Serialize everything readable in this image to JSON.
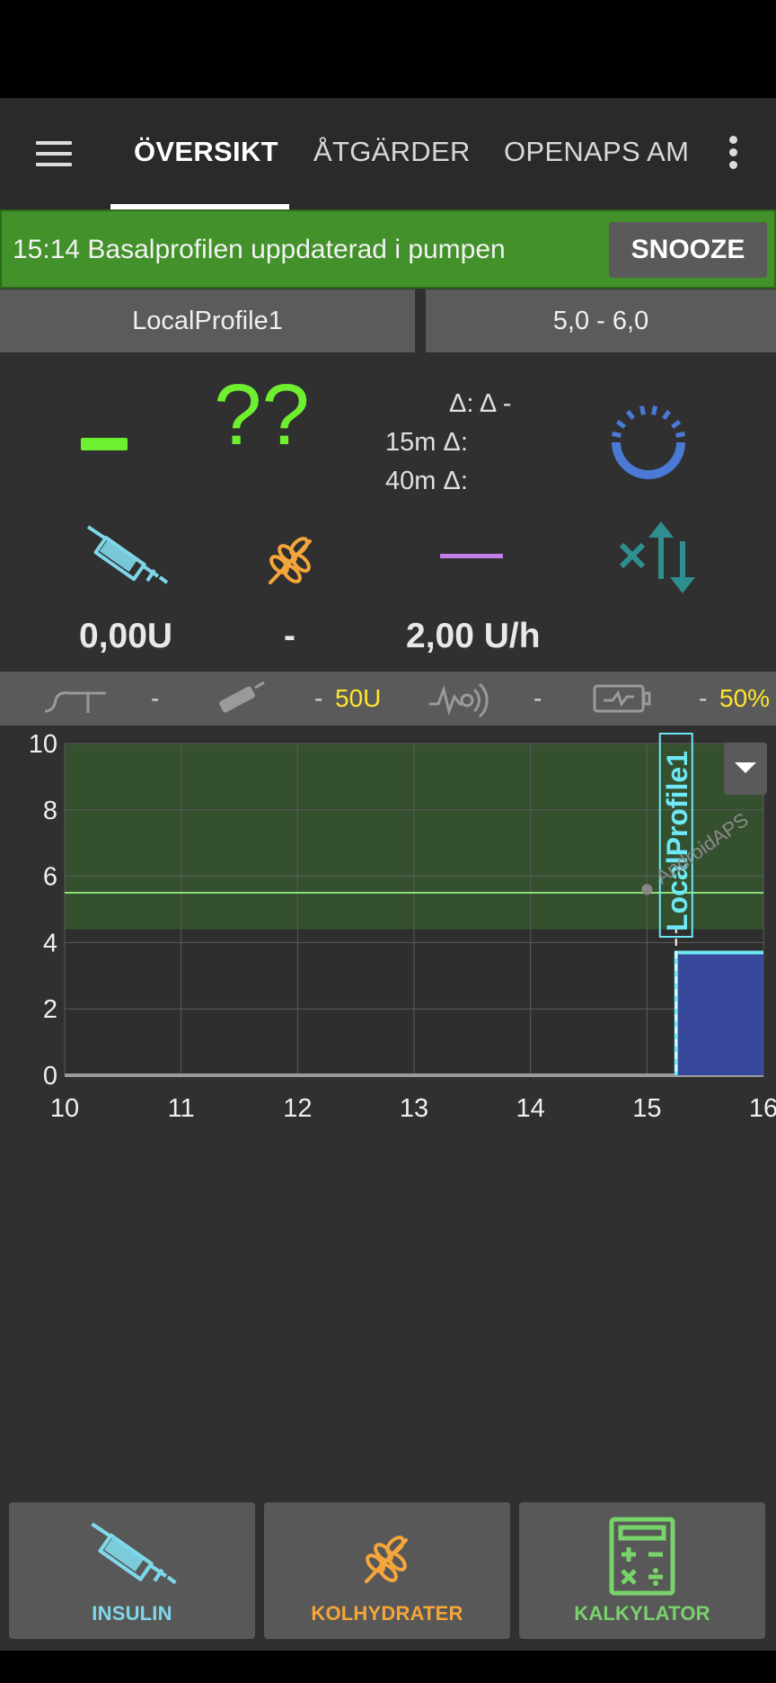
{
  "appbar": {
    "tabs": [
      {
        "label": "ÖVERSIKT",
        "active": true
      },
      {
        "label": "ÅTGÄRDER",
        "active": false
      },
      {
        "label": "OPENAPS AM",
        "active": false
      }
    ],
    "menu_icon": "hamburger-menu-icon",
    "overflow_icon": "more-vert-icon"
  },
  "notification": {
    "text": "15:14 Basalprofilen uppdaterad i pumpen",
    "action": "SNOOZE",
    "color": "#43912a"
  },
  "profile": {
    "name": "LocalProfile1",
    "target": "5,0 - 6,0"
  },
  "glucose": {
    "value": "??",
    "trend": "-",
    "delta": "Δ: Δ -",
    "delta_15m": "15m Δ:",
    "delta_40m": "40m Δ:",
    "color": "#6ef030"
  },
  "info": {
    "iob": "0,00U",
    "cob": "-",
    "basal": "2,00 U/h",
    "icons": [
      "syringe-icon",
      "wheat-icon",
      "basal-line-icon",
      "sensitivity-arrows-icon"
    ]
  },
  "pump_status": {
    "cannula": "-",
    "reservoir_age": "-",
    "reservoir_level": "50U",
    "sensor": "-",
    "battery_age": "-",
    "battery_level": "50%"
  },
  "chart_data": {
    "type": "line",
    "x_ticks": [
      "10",
      "11",
      "12",
      "13",
      "14",
      "15",
      "16"
    ],
    "y_ticks": [
      "0",
      "2",
      "4",
      "6",
      "8",
      "10"
    ],
    "xlim": [
      10,
      16
    ],
    "ylim": [
      0,
      10
    ],
    "target_range": [
      4.4,
      10
    ],
    "target_line": 5.5,
    "basal_block": {
      "start": 15.25,
      "end": 16,
      "value": 3.7
    },
    "profile_switch": {
      "x": 15.25,
      "label": "LocalProfile1"
    },
    "watermark": "AndroidAPS",
    "grid": true
  },
  "actions": [
    {
      "label": "INSULIN",
      "color": "#7fd8ea",
      "icon": "syringe-icon"
    },
    {
      "label": "KOLHYDRATER",
      "color": "#f5a63a",
      "icon": "wheat-icon"
    },
    {
      "label": "KALKYLATOR",
      "color": "#79d36b",
      "icon": "calculator-icon"
    }
  ]
}
